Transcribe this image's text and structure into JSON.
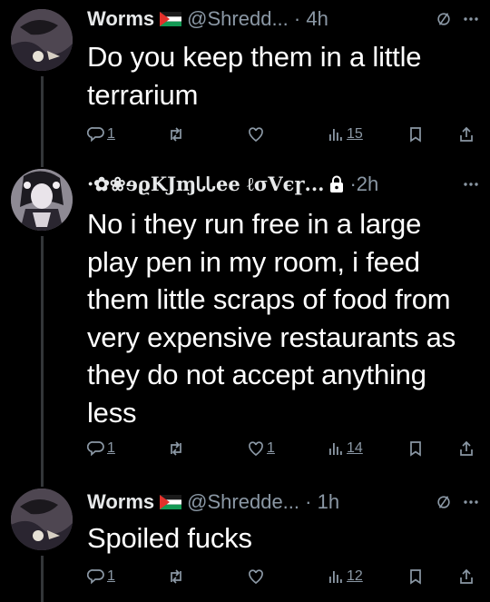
{
  "tweets": [
    {
      "author": "Worms",
      "handle": "@Shredd...",
      "time": "4h",
      "text": "Do you keep them in a little terrarium",
      "replies": "1",
      "likes": "",
      "views": "15",
      "avatar_color": "#4e4651"
    },
    {
      "author": "·✿❀ɘϱKJɱᏓᏓee ℓσVєɼ...",
      "handle": "",
      "time": "2h",
      "text": "No i they run free in a large play pen in my room, i feed them little scraps of food from very expensive restaurants as they do not accept anything less",
      "replies": "1",
      "likes": "1",
      "views": "14",
      "avatar_color": "#8e8a94"
    },
    {
      "author": "Worms",
      "handle": "@Shredde...",
      "time": "1h",
      "text": "Spoiled fucks",
      "replies": "1",
      "likes": "",
      "views": "12",
      "avatar_color": "#4e4651"
    }
  ],
  "icons": {
    "flag": "palestine-flag-icon",
    "grok": "grok-icon",
    "more": "more-icon",
    "lock": "lock-icon",
    "reply": "reply-icon",
    "retweet": "retweet-icon",
    "like": "heart-icon",
    "views": "views-icon",
    "bookmark": "bookmark-icon",
    "share": "share-icon"
  },
  "colors": {
    "background": "#000000",
    "text": "#ffffff",
    "muted": "#8b98a5",
    "thread_line": "#333639"
  }
}
